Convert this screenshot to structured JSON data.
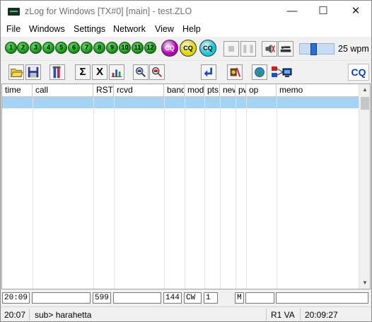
{
  "window": {
    "title": "zLog for Windows [TX#0] [main] - test.ZLO",
    "minimize_glyph": "—",
    "maximize_glyph": "☐",
    "close_glyph": "✕"
  },
  "menu": [
    "File",
    "Windows",
    "Settings",
    "Network",
    "View",
    "Help"
  ],
  "toolbar1": {
    "memory_keys": [
      "1",
      "2",
      "3",
      "4",
      "5",
      "6",
      "7",
      "8",
      "9",
      "10",
      "11",
      "12"
    ],
    "cq_labels": [
      "CQ",
      "CQ",
      "CQ"
    ],
    "cq_colors": [
      "#b800b8",
      "#e0d800",
      "#18c8d8"
    ],
    "speed_fraction": 0.36,
    "wpm_label": "25 wpm"
  },
  "toolbar2": {
    "icons": [
      "open-icon",
      "save-icon",
      "partial-check-icon",
      "sigma-icon",
      "x-icon",
      "bar-chart-icon",
      "zoom-in-icon",
      "zoom-out-icon",
      "return-arrow-icon",
      "rig-icon",
      "globe-icon",
      "network-icon"
    ],
    "sigma": "Σ",
    "x": "X",
    "cq_indicator": "CQ"
  },
  "grid": {
    "columns": [
      "time",
      "call",
      "RST",
      "rcvd",
      "band",
      "mod",
      "pts",
      "new",
      "pw",
      "op",
      "memo"
    ]
  },
  "entry": {
    "time": "20:09",
    "call": "",
    "rst": "599",
    "rcvd": "",
    "band": "144",
    "mode": "CW",
    "power": "1",
    "blank": "",
    "pw": "M",
    "op": "",
    "memo": ""
  },
  "status": {
    "time": "20:07",
    "message": "sub> harahetta",
    "rig": "R1 VA",
    "clock": "20:09:27"
  }
}
